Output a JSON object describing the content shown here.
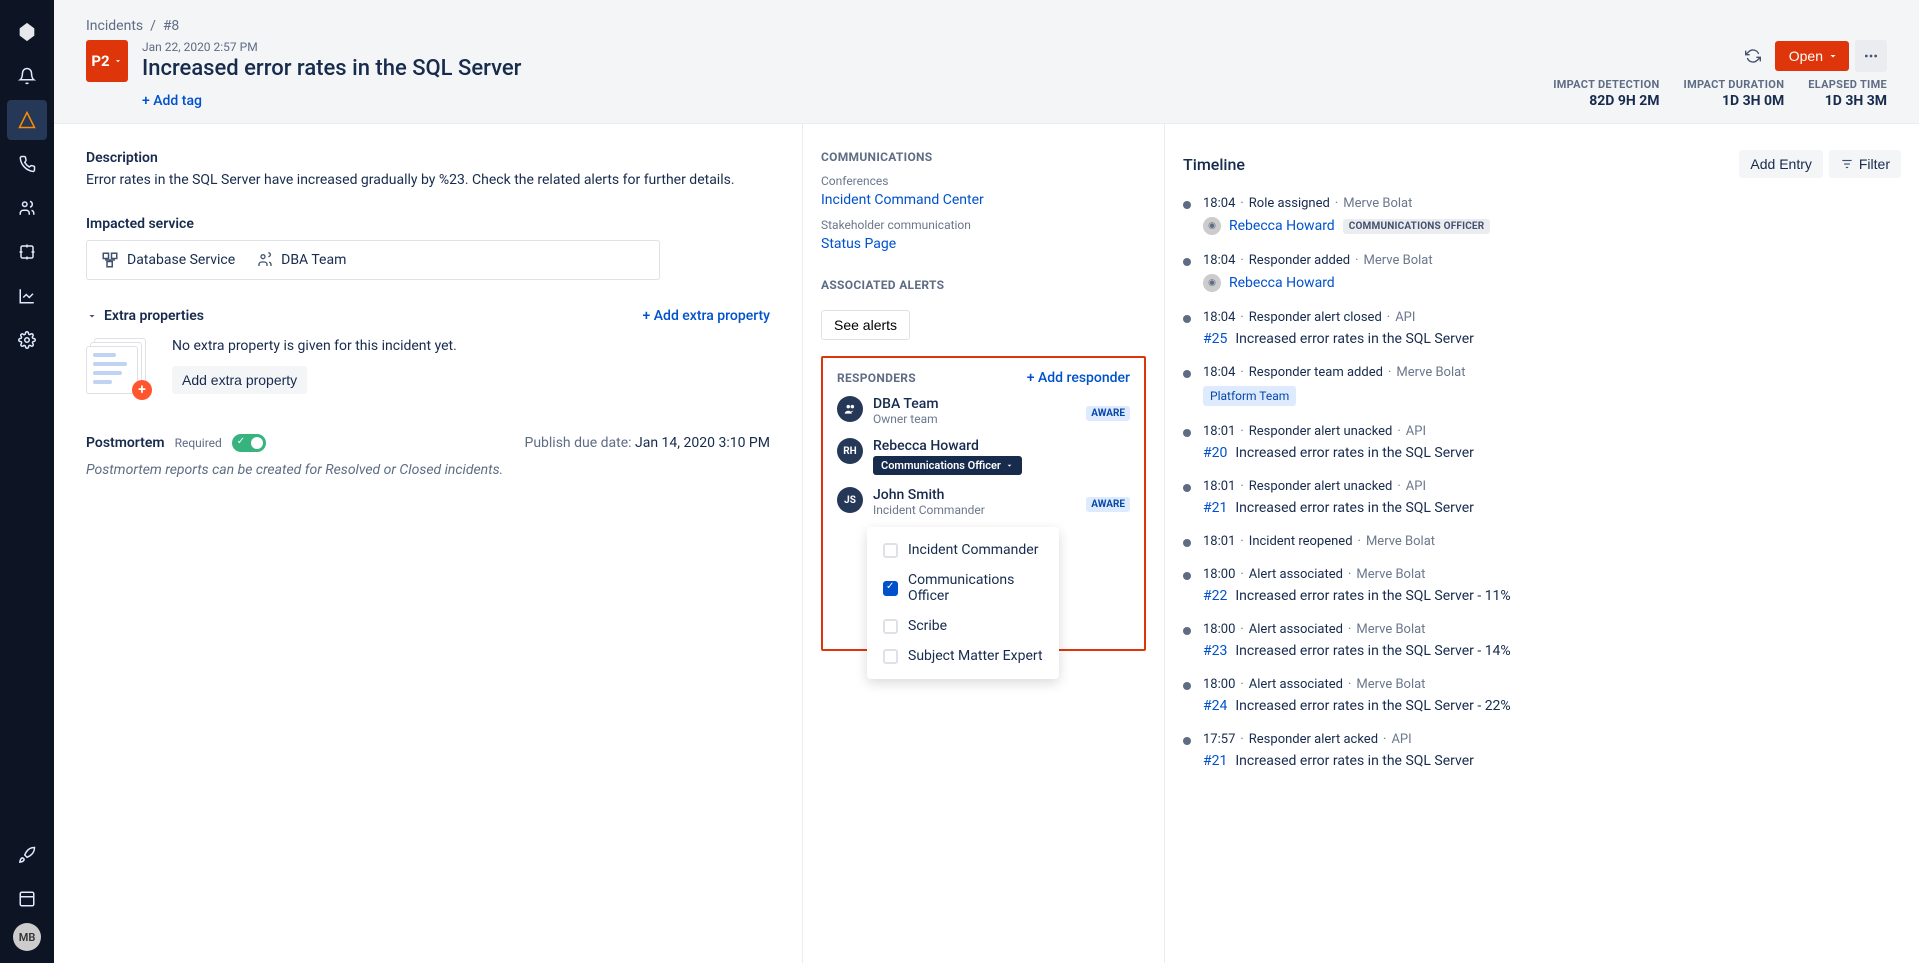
{
  "breadcrumb": {
    "root": "Incidents",
    "id": "#8"
  },
  "header": {
    "priority": "P2",
    "date": "Jan 22, 2020 2:57 PM",
    "title": "Increased error rates in the SQL Server",
    "add_tag": "+ Add tag",
    "open_btn": "Open",
    "stats": [
      {
        "label": "IMPACT DETECTION",
        "value": "82D 9H 2M"
      },
      {
        "label": "IMPACT DURATION",
        "value": "1D 3H 0M"
      },
      {
        "label": "ELAPSED TIME",
        "value": "1D 3H 3M"
      }
    ]
  },
  "description": {
    "heading": "Description",
    "text": "Error rates in the SQL Server have increased gradually by %23. Check the related alerts for further details."
  },
  "impacted": {
    "heading": "Impacted service",
    "service": "Database Service",
    "team": "DBA Team"
  },
  "extra": {
    "heading": "Extra properties",
    "add_link": "+ Add extra property",
    "empty_text": "No extra property is given for this incident yet.",
    "add_btn": "Add extra property"
  },
  "postmortem": {
    "heading": "Postmortem",
    "required": "Required",
    "due_label": "Publish due date: ",
    "due_value": "Jan 14, 2020 3:10 PM",
    "note": "Postmortem reports can be created for Resolved or Closed incidents."
  },
  "communications": {
    "heading": "COMMUNICATIONS",
    "conf_label": "Conferences",
    "conf_link": "Incident Command Center",
    "stake_label": "Stakeholder communication",
    "stake_link": "Status Page"
  },
  "alerts": {
    "heading": "ASSOCIATED ALERTS",
    "see_btn": "See alerts"
  },
  "responders": {
    "heading": "RESPONDERS",
    "add_link": "+ Add responder",
    "aware": "AWARE",
    "items": [
      {
        "avatar": "👥",
        "name": "DBA Team",
        "sub": "Owner team",
        "aware": true,
        "team": true
      },
      {
        "avatar": "RH",
        "name": "Rebecca Howard",
        "role": "Communications Officer"
      },
      {
        "avatar": "JS",
        "name": "John Smith",
        "sub": "Incident Commander",
        "aware": true
      }
    ],
    "dropdown": [
      {
        "label": "Incident Commander",
        "checked": false
      },
      {
        "label": "Communications Officer",
        "checked": true
      },
      {
        "label": "Scribe",
        "checked": false
      },
      {
        "label": "Subject Matter Expert",
        "checked": false
      }
    ]
  },
  "timeline": {
    "heading": "Timeline",
    "add_entry": "Add Entry",
    "filter": "Filter",
    "entries": [
      {
        "time": "18:04",
        "event": "Role assigned",
        "actor": "Merve Bolat",
        "sub_type": "user_role",
        "user": "Rebecca Howard",
        "role": "COMMUNICATIONS OFFICER"
      },
      {
        "time": "18:04",
        "event": "Responder added",
        "actor": "Merve Bolat",
        "sub_type": "user",
        "user": "Rebecca Howard"
      },
      {
        "time": "18:04",
        "event": "Responder alert closed",
        "actor": "API",
        "sub_type": "alert",
        "ref": "#25",
        "text": "Increased error rates in the SQL Server"
      },
      {
        "time": "18:04",
        "event": "Responder team added",
        "actor": "Merve Bolat",
        "sub_type": "team",
        "team": "Platform Team"
      },
      {
        "time": "18:01",
        "event": "Responder alert unacked",
        "actor": "API",
        "sub_type": "alert",
        "ref": "#20",
        "text": "Increased error rates in the SQL Server"
      },
      {
        "time": "18:01",
        "event": "Responder alert unacked",
        "actor": "API",
        "sub_type": "alert",
        "ref": "#21",
        "text": "Increased error rates in the SQL Server"
      },
      {
        "time": "18:01",
        "event": "Incident reopened",
        "actor": "Merve Bolat"
      },
      {
        "time": "18:00",
        "event": "Alert associated",
        "actor": "Merve Bolat",
        "sub_type": "alert",
        "ref": "#22",
        "text": "Increased error rates in the SQL Server - 11%"
      },
      {
        "time": "18:00",
        "event": "Alert associated",
        "actor": "Merve Bolat",
        "sub_type": "alert",
        "ref": "#23",
        "text": "Increased error rates in the SQL Server - 14%"
      },
      {
        "time": "18:00",
        "event": "Alert associated",
        "actor": "Merve Bolat",
        "sub_type": "alert",
        "ref": "#24",
        "text": "Increased error rates in the SQL Server - 22%"
      },
      {
        "time": "17:57",
        "event": "Responder alert acked",
        "actor": "API",
        "sub_type": "alert",
        "ref": "#21",
        "text": "Increased error rates in the SQL Server"
      }
    ]
  },
  "sidebar_avatar": "MB"
}
